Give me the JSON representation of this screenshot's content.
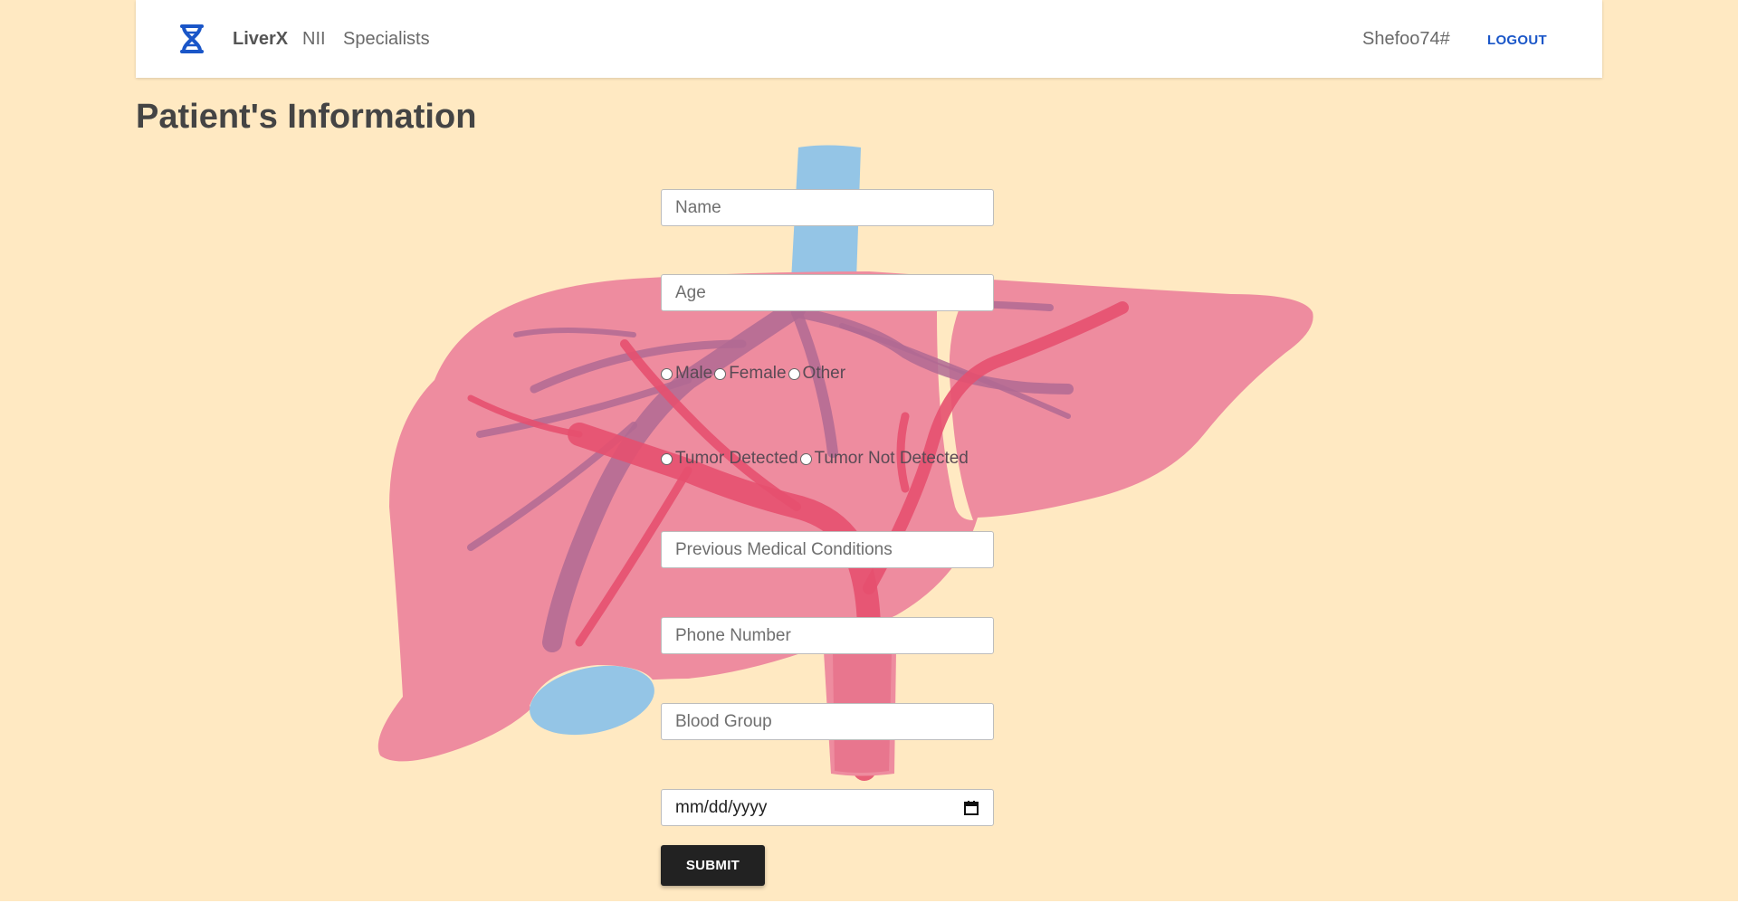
{
  "navbar": {
    "brand_icon": "dna-icon",
    "brand": "LiverX",
    "links": [
      "NII",
      "Specialists"
    ],
    "username": "Shefoo74#",
    "logout": "LOGOUT"
  },
  "page": {
    "title": "Patient's Information"
  },
  "form": {
    "name_placeholder": "Name",
    "age_placeholder": "Age",
    "gender_options": [
      "Male",
      "Female",
      "Other"
    ],
    "tumor_options": [
      "Tumor Detected",
      "Tumor Not Detected"
    ],
    "conditions_placeholder": "Previous Medical Conditions",
    "phone_placeholder": "Phone Number",
    "blood_placeholder": "Blood Group",
    "date_value": "mm/dd/yyyy",
    "date_icon": "calendar-icon",
    "submit": "SUBMIT"
  },
  "colors": {
    "background": "#ffe9c2",
    "liver": "#ee8c9f",
    "vessel_blue": "#94c5e6",
    "vessel_red": "#e6506f",
    "vessel_purple": "#b06a93",
    "brand_blue": "#1a56c8"
  }
}
